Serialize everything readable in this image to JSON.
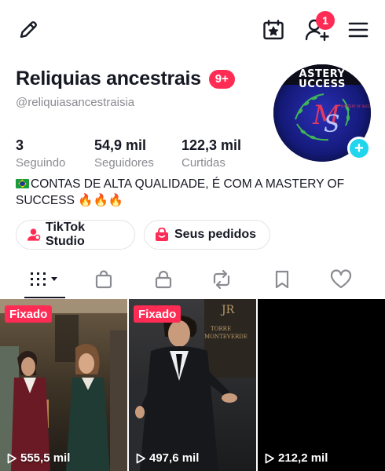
{
  "topbar": {
    "edit_icon": "pencil-icon",
    "calendar_icon": "calendar-star-icon",
    "add_friends_icon": "person-add-icon",
    "notification_count": "1",
    "menu_icon": "hamburger-menu-icon"
  },
  "profile": {
    "display_name": "Reliquias ancestrais",
    "name_badge": "9+",
    "username": "@reliquiasancestraisia",
    "avatar_text": "ASTERY\nUCCESS",
    "avatar_add_icon": "plus-icon"
  },
  "stats": [
    {
      "value": "3",
      "label": "Seguindo"
    },
    {
      "value": "54,9 mil",
      "label": "Seguidores"
    },
    {
      "value": "122,3 mil",
      "label": "Curtidas"
    }
  ],
  "bio": {
    "line1": "CONTAS DE ALTA QUALIDADE, É COM A MASTERY OF",
    "line2": "SUCCESS 🔥🔥🔥"
  },
  "buttons": {
    "studio": "TikTok Studio",
    "orders": "Seus pedidos"
  },
  "tabs": [
    {
      "name": "videos",
      "icon": "grid-icon",
      "active": true
    },
    {
      "name": "shop",
      "icon": "shopping-bag-icon",
      "active": false
    },
    {
      "name": "private",
      "icon": "lock-icon",
      "active": false
    },
    {
      "name": "reposts",
      "icon": "repost-icon",
      "active": false
    },
    {
      "name": "favorites",
      "icon": "bookmark-icon",
      "active": false
    },
    {
      "name": "liked",
      "icon": "heart-icon",
      "active": false
    }
  ],
  "videos": [
    {
      "pinned": "Fixado",
      "views": "555,5 mil"
    },
    {
      "pinned": "Fixado",
      "views": "497,6 mil"
    },
    {
      "pinned": "",
      "views": "212,2 mil"
    }
  ],
  "colors": {
    "accent": "#fe2c55",
    "avatar_plus": "#20d5ec",
    "text": "#161823",
    "muted": "#8a8b91"
  }
}
